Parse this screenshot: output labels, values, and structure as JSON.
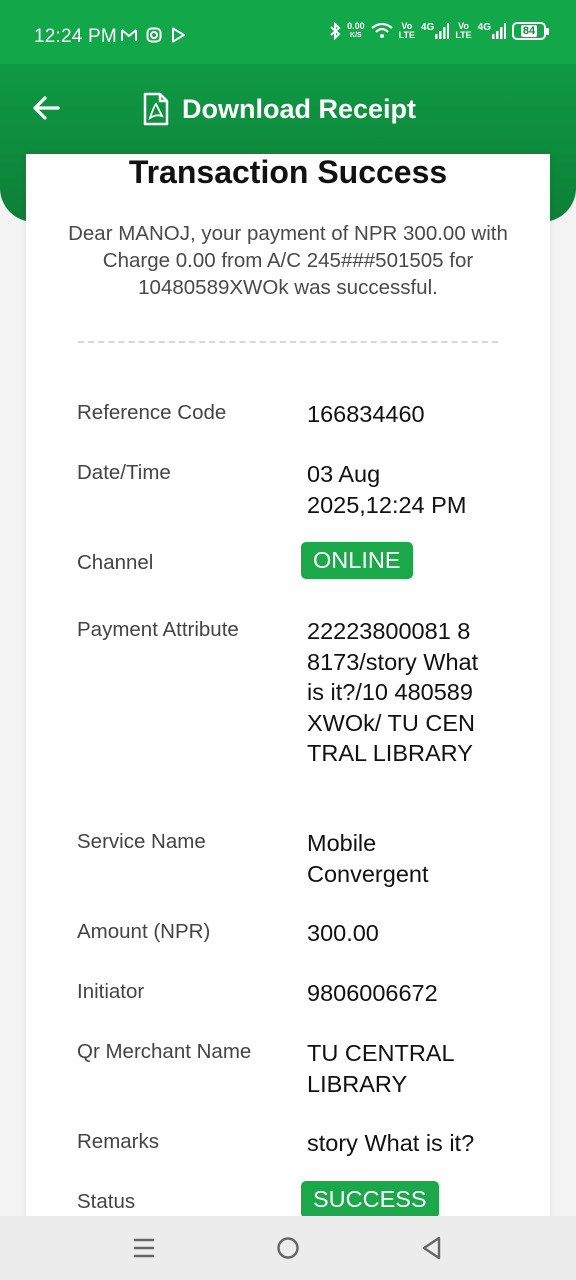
{
  "status_bar": {
    "time": "12:24 PM",
    "net_speed_top": "0.00",
    "net_speed_unit": "K/S",
    "volte1": "Vo",
    "volte1b": "LTE",
    "net1": "4G",
    "volte2": "Vo",
    "volte2b": "LTE",
    "net2": "4G",
    "battery": "84"
  },
  "header": {
    "title": "Download Receipt"
  },
  "receipt": {
    "title": "Transaction Success",
    "message": "Dear MANOJ, your payment of NPR 300.00 with Charge 0.00 from A/C 245###501505 for 10480589XWOk was successful.",
    "rows": [
      {
        "key": "Reference Code",
        "value": "166834460"
      },
      {
        "key": "Date/Time",
        "value": "03 Aug 2025,12:24 PM"
      },
      {
        "key": "Channel",
        "value": "ONLINE"
      },
      {
        "key": "Payment Attribute",
        "value": "22223800081 88173/story What is it?/10 480589XWOk/ TU CENTRAL LIBRARY"
      },
      {
        "key": "Service Name",
        "value": "Mobile Convergent"
      },
      {
        "key": "Amount (NPR)",
        "value": "300.00"
      },
      {
        "key": "Initiator",
        "value": "9806006672"
      },
      {
        "key": "Qr Merchant Name",
        "value": "TU CENTRAL LIBRARY"
      },
      {
        "key": "Remarks",
        "value": "story What is it?"
      },
      {
        "key": "Status",
        "value": "SUCCESS"
      }
    ]
  },
  "colors": {
    "primary_green": "#12a84a",
    "dark_green": "#0d7f37",
    "badge_green": "#1aa84a"
  },
  "icons": {
    "back": "arrow-left-icon",
    "pdf": "pdf-file-icon",
    "gmail": "gmail-icon",
    "instagram": "instagram-icon",
    "play_store": "play-store-icon",
    "bluetooth": "bluetooth-icon",
    "wifi": "wifi-icon",
    "nav_recent": "recent-apps-icon",
    "nav_home": "home-icon",
    "nav_back": "back-triangle-icon"
  }
}
